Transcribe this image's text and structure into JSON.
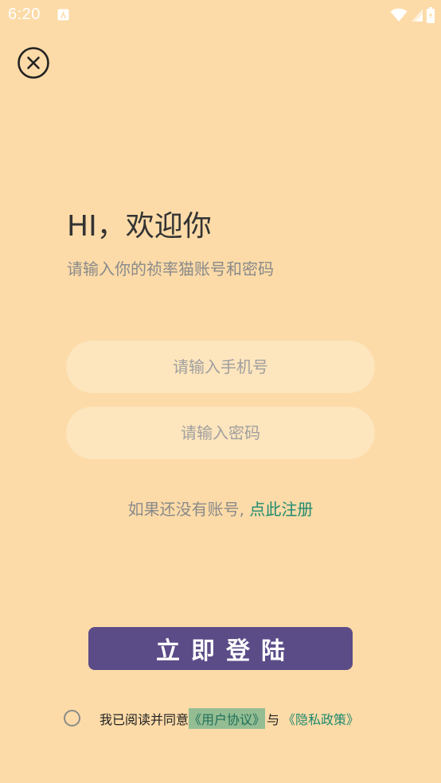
{
  "status_bar": {
    "time": "6:20"
  },
  "login": {
    "title": "HI，欢迎你",
    "subtitle": "请输入你的祯率猫账号和密码",
    "phone_placeholder": "请输入手机号",
    "password_placeholder": "请输入密码",
    "register_prompt": "如果还没有账号,",
    "register_link": " 点此注册",
    "login_button": "立即登陆"
  },
  "agreement": {
    "prefix": "我已阅读并同意",
    "user_agreement": "《用户协议》",
    "separator": "与",
    "privacy_policy": "《隐私政策》"
  },
  "colors": {
    "background": "#fcdba8",
    "input_background": "#fde5bd",
    "accent_link": "#1e8a6e",
    "button": "#5b4c88"
  },
  "icons": {
    "close": "close-circle-icon",
    "wifi": "wifi-icon",
    "signal": "signal-icon",
    "battery": "battery-icon"
  }
}
